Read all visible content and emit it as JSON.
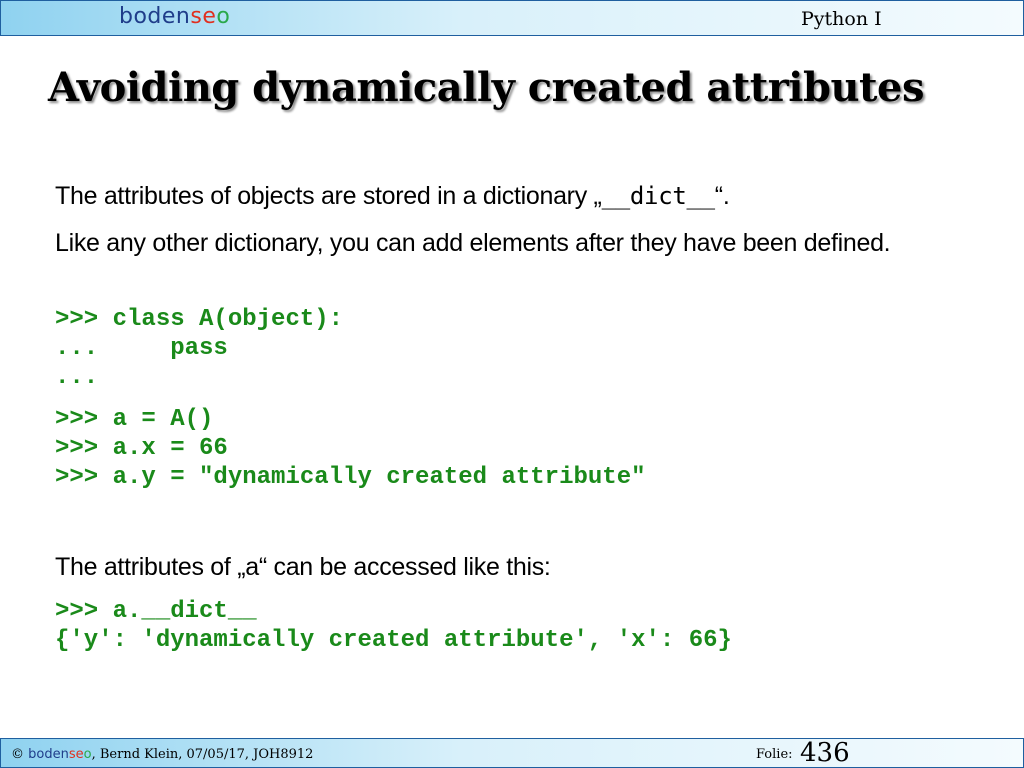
{
  "header": {
    "logo": {
      "part1": "boden",
      "part2": "s",
      "part3": "e",
      "part4": "o"
    },
    "course": "Python I"
  },
  "slide": {
    "title": "Avoiding dynamically created attributes",
    "p1": {
      "before": "The attributes of objects are stored in a dictionary „",
      "code": "__dict__",
      "after": "“."
    },
    "p2": "Like any other dictionary, you can add elements after they have been defined.",
    "code1": [
      ">>> class A(object):",
      "...     pass",
      "..."
    ],
    "code2": [
      ">>> a = A()",
      ">>> a.x = 66",
      ">>> a.y = \"dynamically created attribute\""
    ],
    "p3": "The attributes of „a“ can be accessed like this:",
    "code3": [
      ">>> a.__dict__",
      "{'y': 'dynamically created attribute', 'x': 66}"
    ]
  },
  "footer": {
    "copyright_symbol": "©",
    "brand": {
      "part1": "boden",
      "part2": "s",
      "part3": "e",
      "part4": "o"
    },
    "info": ", Bernd Klein, 07/05/17, JOH8912",
    "folie_label": "Folie:",
    "slide_number": "436"
  },
  "colors": {
    "code_green": "#1a8a1a",
    "bar_light": "#d8f0fa",
    "bar_blue": "#8fd2f0",
    "logo_blue": "#1f3d8a",
    "logo_red": "#e03020",
    "logo_green": "#2aa84a"
  }
}
